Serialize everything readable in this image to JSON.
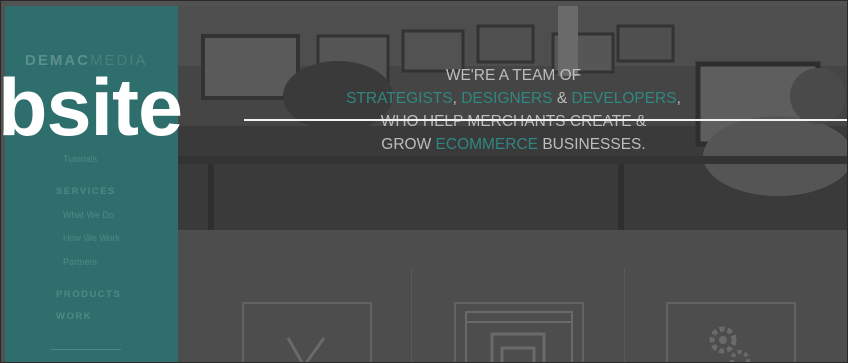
{
  "logo": {
    "part1": "DEMAC",
    "part2": "MEDIA"
  },
  "sidebar": {
    "items": [
      {
        "label": "Tutorials"
      },
      {
        "label": "SERVICES"
      },
      {
        "label": "What We Do"
      },
      {
        "label": "How We Work"
      },
      {
        "label": "Partners"
      },
      {
        "label": "PRODUCTS"
      },
      {
        "label": "WORK"
      }
    ]
  },
  "hero": {
    "line1": "WE'RE A TEAM OF",
    "line2_a": "STRATEGISTS",
    "line2_b": ", ",
    "line2_c": "DESIGNERS",
    "line2_d": " & ",
    "line2_e": "DEVELOPERS",
    "line2_f": ",",
    "line3": "WHO HELP MERCHANTS CREATE &",
    "line4_a": "GROW ",
    "line4_b": "ECOMMERCE",
    "line4_c": " BUSINESSES."
  },
  "overlay": {
    "word": "bsite"
  },
  "colors": {
    "sidebar": "#2e6f6d",
    "highlight": "#2f8782",
    "hero_text": "#bdbdbd"
  },
  "features": {
    "icons": [
      "check-chart-icon",
      "browser-window-icon",
      "gears-icon"
    ]
  }
}
